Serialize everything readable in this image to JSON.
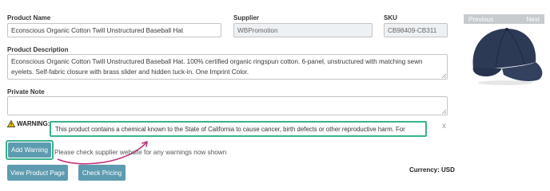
{
  "form": {
    "product_name_label": "Product Name",
    "product_name_value": "Econscious Organic Cotton Twill Unstructured Baseball Hat",
    "supplier_label": "Supplier",
    "supplier_value": "WBPromotion",
    "sku_label": "SKU",
    "sku_value": "CB98409-CB311",
    "description_label": "Product Description",
    "description_value": "Econscious Organic Cotton Twill Unstructured Baseball Hat. 100% certified organic ringspun cotton. 6-panel, unstructured with matching sewn eyelets. Self-fabric closure with brass slider and hidden tuck-in. One Imprint Color.",
    "private_note_label": "Private Note",
    "private_note_value": ""
  },
  "warning": {
    "label": "WARNING:",
    "text": "This product contains a chemical known to the State of California to cause cancer, birth defects or other reproductive harm.  For",
    "close": "x",
    "add_button": "Add Warning",
    "hint": "Please check supplier website for any warnings now shown"
  },
  "actions": {
    "view_product": "View Product Page",
    "check_pricing": "Check Pricing",
    "currency": "Currency: USD"
  },
  "gallery": {
    "previous": "Previous",
    "next": "Next"
  },
  "colors": {
    "accent_button": "#5d9bb0",
    "highlight": "#38b28a",
    "annotation_arrow": "#c0307a",
    "hat": "#2d3a56"
  }
}
